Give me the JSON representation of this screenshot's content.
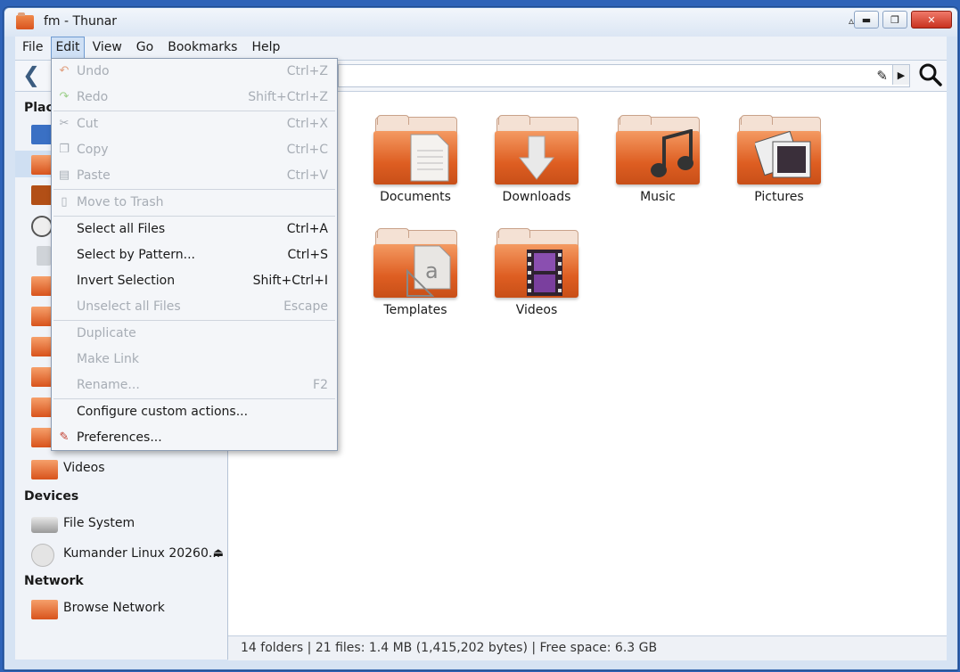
{
  "window": {
    "title": "fm - Thunar"
  },
  "menubar": [
    "File",
    "Edit",
    "View",
    "Go",
    "Bookmarks",
    "Help"
  ],
  "edit_menu": [
    {
      "label": "Undo",
      "accel": "Ctrl+Z",
      "enabled": false,
      "icon": "undo-icon"
    },
    {
      "label": "Redo",
      "accel": "Shift+Ctrl+Z",
      "enabled": false,
      "icon": "redo-icon"
    },
    {
      "label": "Cut",
      "accel": "Ctrl+X",
      "enabled": false,
      "icon": "cut-icon"
    },
    {
      "label": "Copy",
      "accel": "Ctrl+C",
      "enabled": false,
      "icon": "copy-icon"
    },
    {
      "label": "Paste",
      "accel": "Ctrl+V",
      "enabled": false,
      "icon": "paste-icon"
    },
    {
      "label": "Move to Trash",
      "accel": "",
      "enabled": false,
      "icon": "trash-icon"
    },
    {
      "label": "Select all Files",
      "accel": "Ctrl+A",
      "enabled": true,
      "icon": ""
    },
    {
      "label": "Select by Pattern...",
      "accel": "Ctrl+S",
      "enabled": true,
      "icon": ""
    },
    {
      "label": "Invert Selection",
      "accel": "Shift+Ctrl+I",
      "enabled": true,
      "icon": ""
    },
    {
      "label": "Unselect all Files",
      "accel": "Escape",
      "enabled": false,
      "icon": ""
    },
    {
      "label": "Duplicate",
      "accel": "",
      "enabled": false,
      "icon": ""
    },
    {
      "label": "Make Link",
      "accel": "",
      "enabled": false,
      "icon": ""
    },
    {
      "label": "Rename...",
      "accel": "F2",
      "enabled": false,
      "icon": ""
    },
    {
      "label": "Configure custom actions...",
      "accel": "",
      "enabled": true,
      "icon": ""
    },
    {
      "label": "Preferences...",
      "accel": "",
      "enabled": true,
      "icon": "preferences-icon"
    }
  ],
  "sidebar": {
    "places_header": "Plac",
    "places_last": "Videos",
    "devices_header": "Devices",
    "devices": [
      "File System",
      "Kumander Linux 20260..."
    ],
    "network_header": "Network",
    "network": [
      "Browse Network"
    ]
  },
  "folders": [
    {
      "label": "Documents",
      "emblem": "document-icon"
    },
    {
      "label": "Downloads",
      "emblem": "download-arrow-icon"
    },
    {
      "label": "Music",
      "emblem": "music-note-icon"
    },
    {
      "label": "Pictures",
      "emblem": "photo-icon"
    },
    {
      "label": "Templates",
      "emblem": "template-icon"
    },
    {
      "label": "Videos",
      "emblem": "film-icon"
    }
  ],
  "status": "14 folders  |  21 files: 1.4 MB (1,415,202 bytes)  |  Free space: 6.3 GB",
  "colors": {
    "folder_orange": "#de5e22",
    "titlebar_blue": "#2e63b8",
    "menu_highlight": "#cfe0f5"
  }
}
